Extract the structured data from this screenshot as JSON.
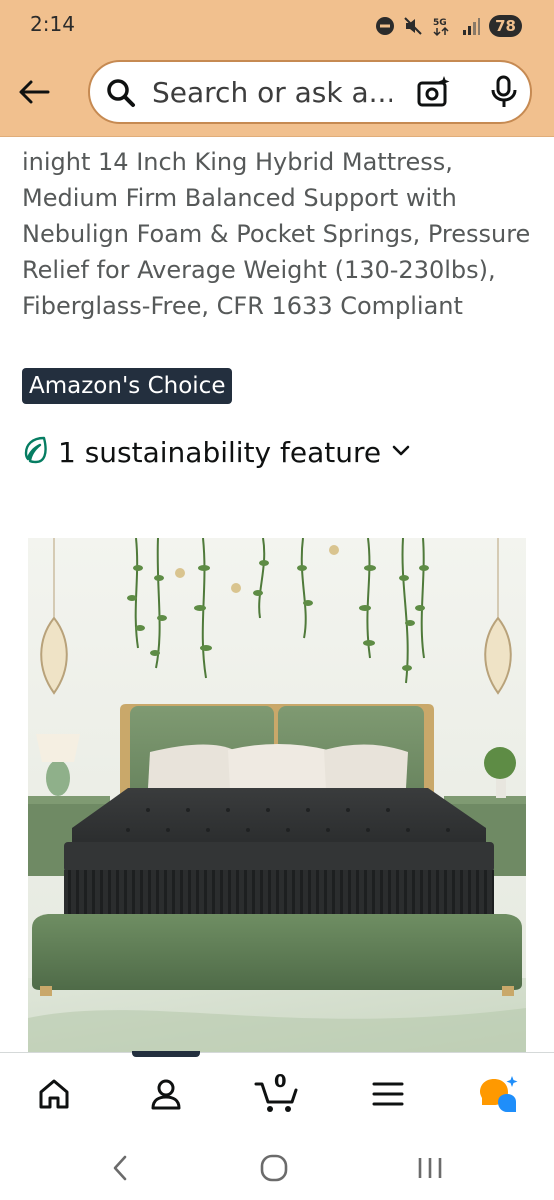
{
  "status_bar": {
    "time": "2:14",
    "battery": "78",
    "icons": [
      "do-not-disturb-icon",
      "mute-icon",
      "5g-icon",
      "signal-icon",
      "battery-icon"
    ]
  },
  "header": {
    "back_icon": "arrow-left-icon",
    "search_placeholder": "Search or ask a...",
    "camera_icon": "camera-sparkle-icon",
    "mic_icon": "microphone-icon"
  },
  "product": {
    "title": "inight 14 Inch King Hybrid Mattress, Medium Firm Balanced Support with Nebulign Foam & Pocket Springs, Pressure Relief for Average Weight (130-230lbs), Fiberglass-Free, CFR 1633 Compliant",
    "badge": "Amazon's Choice",
    "sustainability": "1 sustainability feature"
  },
  "bottom_nav": {
    "items": [
      "home-icon",
      "account-icon",
      "cart-icon",
      "menu-icon",
      "rufus-icon"
    ],
    "cart_count": "0"
  },
  "colors": {
    "header_bg": "#f1c08e",
    "badge_bg": "#232f3e",
    "leaf_green": "#067d62",
    "rufus_orange": "#ff9900",
    "rufus_blue": "#1f8efa"
  }
}
